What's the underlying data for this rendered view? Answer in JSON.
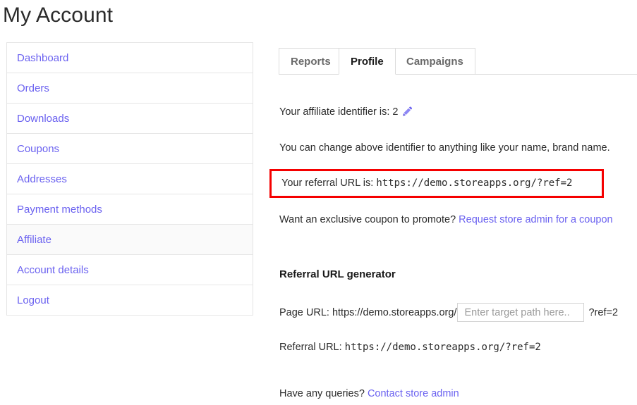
{
  "page": {
    "title": "My Account"
  },
  "sidebar": {
    "items": [
      {
        "label": "Dashboard",
        "active": false
      },
      {
        "label": "Orders",
        "active": false
      },
      {
        "label": "Downloads",
        "active": false
      },
      {
        "label": "Coupons",
        "active": false
      },
      {
        "label": "Addresses",
        "active": false
      },
      {
        "label": "Payment methods",
        "active": false
      },
      {
        "label": "Affiliate",
        "active": true
      },
      {
        "label": "Account details",
        "active": false
      },
      {
        "label": "Logout",
        "active": false
      }
    ]
  },
  "main": {
    "tabs": [
      {
        "label": "Reports",
        "active": false
      },
      {
        "label": "Profile",
        "active": true
      },
      {
        "label": "Campaigns",
        "active": false
      }
    ],
    "identifier": {
      "label": "Your affiliate identifier is:",
      "value": "2",
      "edit_icon": "pencil-icon"
    },
    "change_note": "You can change above identifier to anything like your name, brand name.",
    "referral": {
      "label": "Your referral URL is:",
      "url": "https://demo.storeapps.org/?ref=2",
      "highlight_color": "#f50000"
    },
    "coupon": {
      "text": "Want an exclusive coupon to promote?",
      "link_label": "Request store admin for a coupon"
    },
    "generator": {
      "heading": "Referral URL generator",
      "page_url_label": "Page URL:",
      "base_url": "https://demo.storeapps.org/",
      "input_value": "",
      "input_placeholder": "Enter target path here..",
      "suffix": "?ref=2",
      "referral_url_label": "Referral URL:",
      "referral_url_value": "https://demo.storeapps.org/?ref=2"
    },
    "queries": {
      "text": "Have any queries?",
      "link_label": "Contact store admin"
    }
  },
  "colors": {
    "link": "#6b62f0",
    "highlight": "#f50000",
    "text": "#2b2b2b",
    "border": "#e4e4e4"
  }
}
